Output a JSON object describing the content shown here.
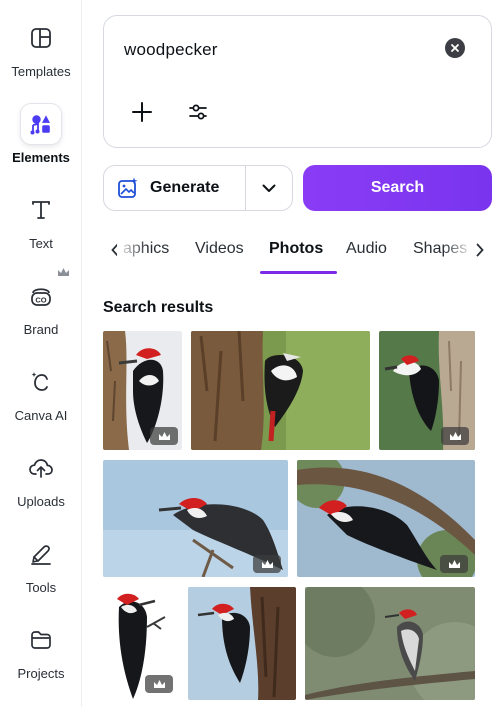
{
  "rail": {
    "items": [
      {
        "label": "Templates",
        "icon": "templates-icon"
      },
      {
        "label": "Elements",
        "icon": "elements-icon",
        "active": true
      },
      {
        "label": "Text",
        "icon": "text-icon"
      },
      {
        "label": "Brand",
        "icon": "brand-icon",
        "premium": true
      },
      {
        "label": "Canva AI",
        "icon": "canva-ai-icon"
      },
      {
        "label": "Uploads",
        "icon": "uploads-icon"
      },
      {
        "label": "Tools",
        "icon": "tools-icon"
      },
      {
        "label": "Projects",
        "icon": "projects-icon"
      }
    ]
  },
  "search": {
    "value": "woodpecker"
  },
  "actions": {
    "generate_label": "Generate",
    "search_label": "Search"
  },
  "tabs": {
    "items": [
      "aphics",
      "Videos",
      "Photos",
      "Audio",
      "Shapes"
    ],
    "active": "Photos"
  },
  "results": {
    "title": "Search results",
    "photos": [
      {
        "subject": "pileated woodpecker on tree trunk",
        "premium": true
      },
      {
        "subject": "great spotted woodpecker on stump",
        "premium": false
      },
      {
        "subject": "pileated woodpecker on dead tree",
        "premium": true
      },
      {
        "subject": "pileated woodpecker on branch, blue sky",
        "premium": true
      },
      {
        "subject": "pileated woodpecker on tree branch",
        "premium": true
      },
      {
        "subject": "pileated woodpecker isolated",
        "premium": true
      },
      {
        "subject": "pileated woodpecker on trunk, blue sky",
        "premium": false
      },
      {
        "subject": "red-bellied woodpecker on branch",
        "premium": false
      }
    ]
  },
  "colors": {
    "accent": "#7d2ae8",
    "search_button": "#8a3cf5",
    "elements_icon": "#4b3bf3"
  }
}
